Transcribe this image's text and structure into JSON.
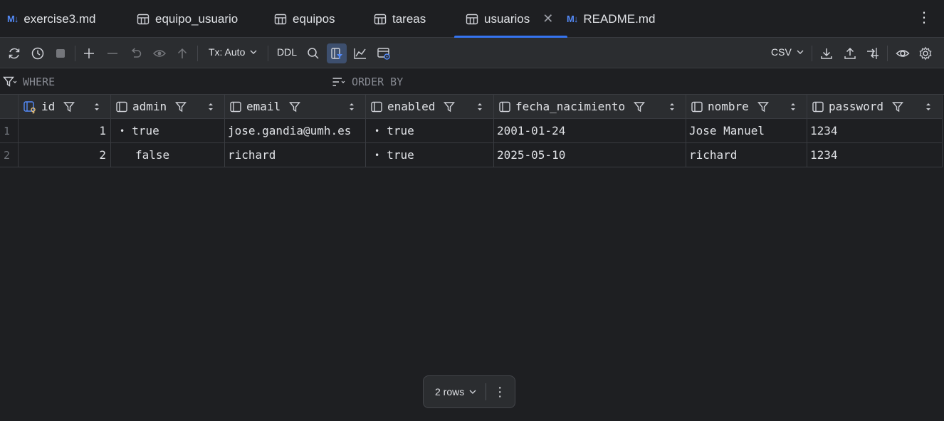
{
  "tabs": [
    {
      "label": "exercise3.md",
      "icon": "markdown-icon",
      "active": false
    },
    {
      "label": "equipo_usuario",
      "icon": "table-icon",
      "active": false
    },
    {
      "label": "equipos",
      "icon": "table-icon",
      "active": false
    },
    {
      "label": "tareas",
      "icon": "table-icon",
      "active": false
    },
    {
      "label": "usuarios",
      "icon": "table-icon",
      "active": true,
      "closable": true
    },
    {
      "label": "README.md",
      "icon": "markdown-icon",
      "active": false
    }
  ],
  "tab_markdown_badge": "M↓",
  "toolbar": {
    "tx_mode": "Tx: Auto",
    "ddl_label": "DDL",
    "export_format": "CSV"
  },
  "filter": {
    "where_placeholder": "WHERE",
    "orderby_placeholder": "ORDER BY"
  },
  "grid": {
    "columns": [
      "id",
      "admin",
      "email",
      "enabled",
      "fecha_nacimiento",
      "nombre",
      "password"
    ],
    "rows": [
      {
        "num": "1",
        "id": "1",
        "admin": "true",
        "email": "jose.gandia@umh.es",
        "enabled": "true",
        "fecha_nacimiento": "2001-01-24",
        "nombre": "Jose Manuel",
        "password": "1234"
      },
      {
        "num": "2",
        "id": "2",
        "admin": "false",
        "email": "richard",
        "enabled": "true",
        "fecha_nacimiento": "2025-05-10",
        "nombre": "richard",
        "password": "1234"
      }
    ]
  },
  "status": {
    "rows_label": "2 rows"
  },
  "colors": {
    "accent": "#3574f0",
    "background": "#1e1f22",
    "panel": "#2b2d30"
  }
}
